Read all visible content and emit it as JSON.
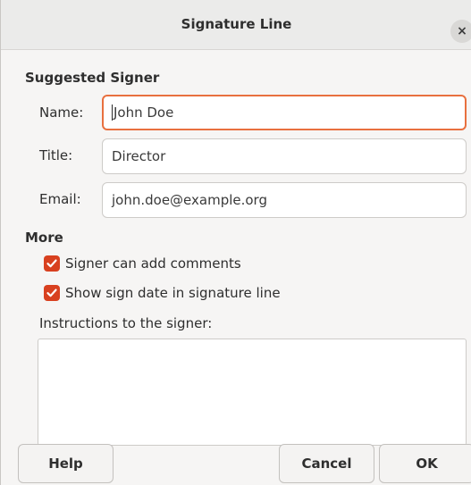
{
  "window": {
    "title": "Signature Line",
    "close_label": "×"
  },
  "suggested_signer": {
    "heading": "Suggested Signer",
    "name_label": "Name:",
    "name_value": "John Doe",
    "title_label": "Title:",
    "title_value": "Director",
    "email_label": "Email:",
    "email_value": "john.doe@example.org"
  },
  "more": {
    "heading": "More",
    "can_add_comments": {
      "label": "Signer can add comments",
      "checked": true
    },
    "show_sign_date": {
      "label": "Show sign date in signature line",
      "checked": true
    },
    "instructions_label": "Instructions to the signer:",
    "instructions_value": ""
  },
  "buttons": {
    "help": "Help",
    "cancel": "Cancel",
    "ok": "OK"
  },
  "colors": {
    "accent": "#d8401f",
    "focus_border": "#e8703f"
  }
}
